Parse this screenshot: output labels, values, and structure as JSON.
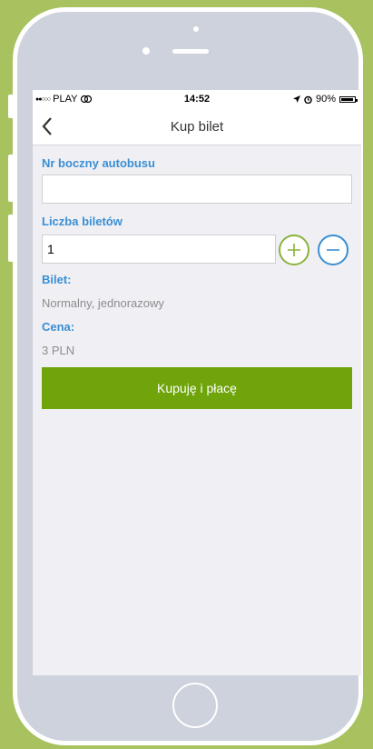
{
  "status_bar": {
    "carrier": "PLAY",
    "time": "14:52",
    "battery": "90%"
  },
  "nav": {
    "title": "Kup bilet"
  },
  "form": {
    "bus_label": "Nr boczny autobusu",
    "bus_value": "",
    "tickets_label": "Liczba biletów",
    "tickets_value": "1",
    "ticket_label": "Bilet:",
    "ticket_value": "Normalny, jednorazowy",
    "price_label": "Cena:",
    "price_value": "3 PLN",
    "buy_button": "Kupuję i płacę"
  },
  "colors": {
    "accent_blue": "#3a8fd3",
    "accent_green": "#6fa40a",
    "background": "#a7c25f"
  }
}
